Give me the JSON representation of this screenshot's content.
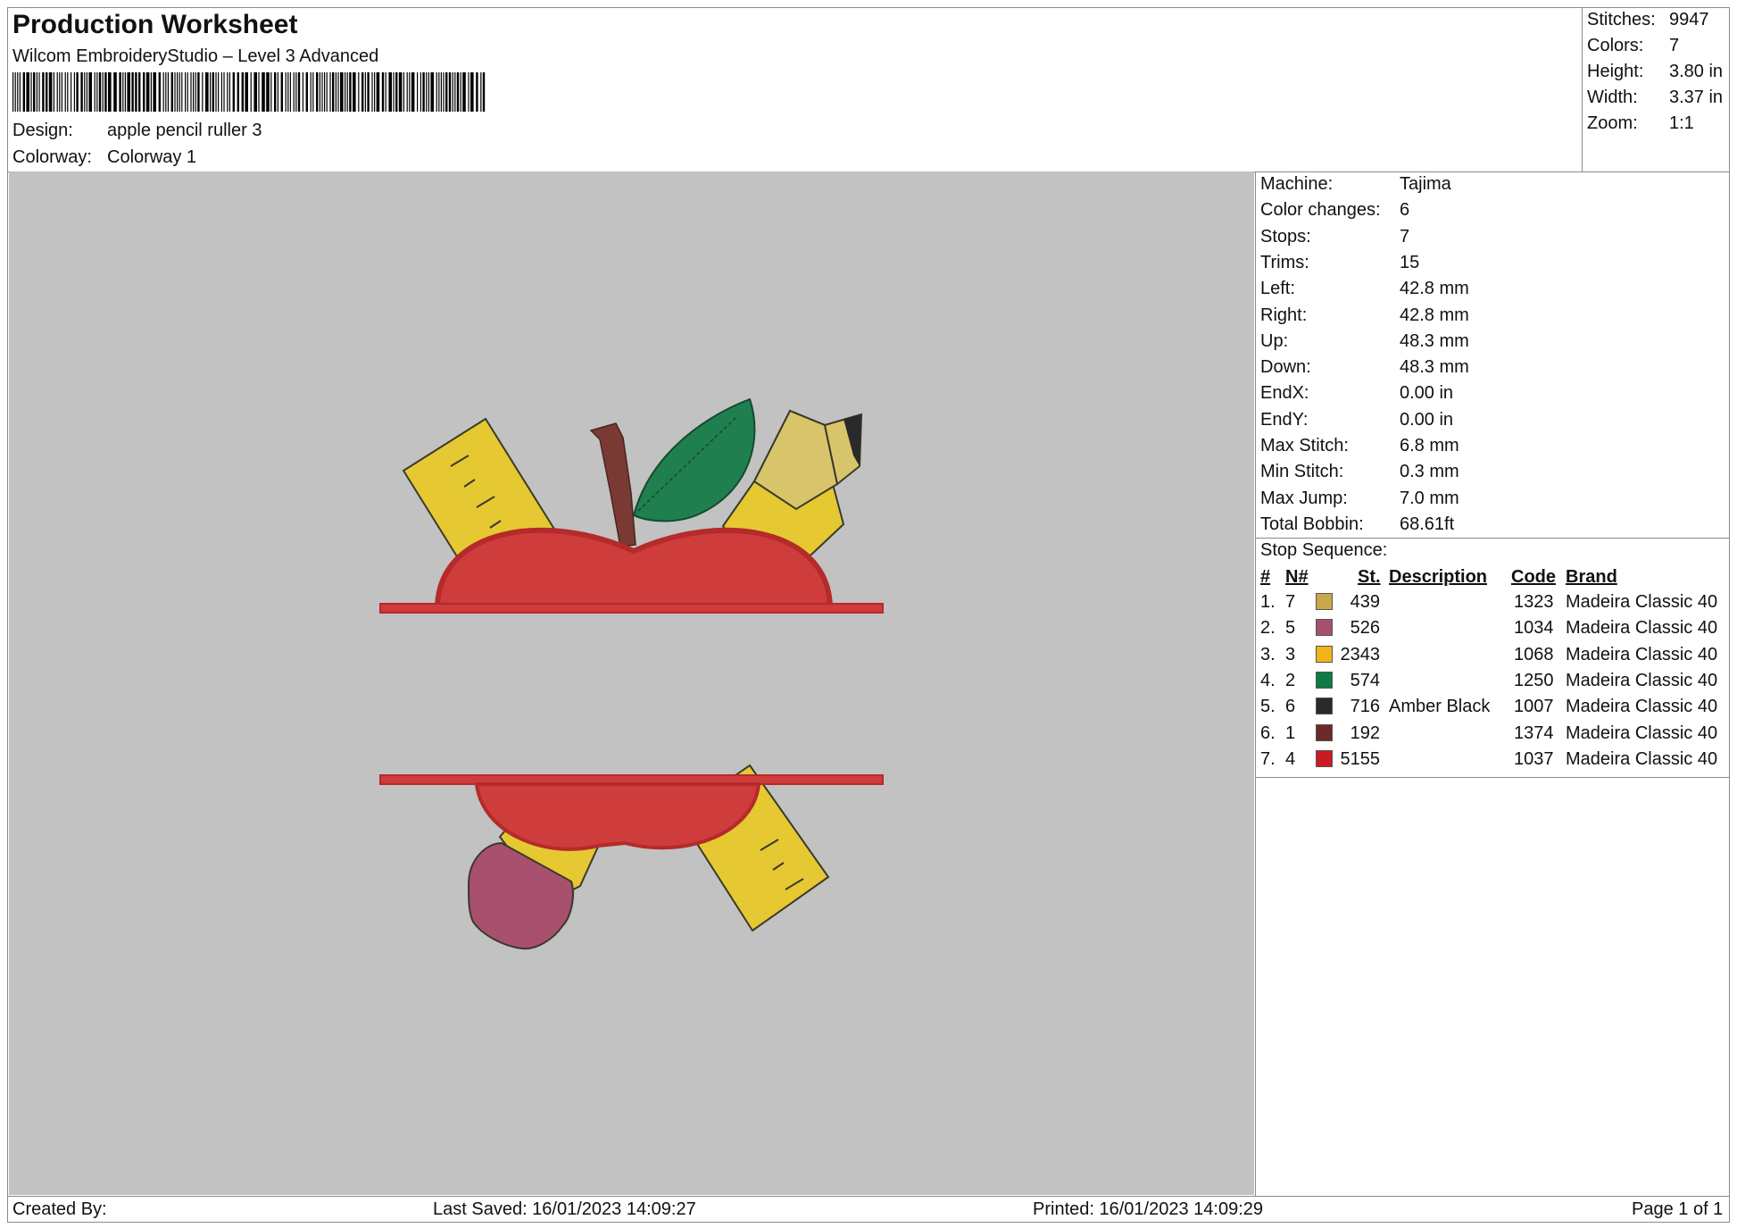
{
  "header": {
    "title": "Production Worksheet",
    "software": "Wilcom EmbroideryStudio – Level 3 Advanced",
    "design_label": "Design:",
    "design_value": "apple pencil ruller 3",
    "colorway_label": "Colorway:",
    "colorway_value": "Colorway 1"
  },
  "summary": [
    {
      "label": "Stitches:",
      "value": "9947"
    },
    {
      "label": "Colors:",
      "value": "7"
    },
    {
      "label": "Height:",
      "value": "3.80 in"
    },
    {
      "label": "Width:",
      "value": "3.37 in"
    },
    {
      "label": "Zoom:",
      "value": "1:1"
    }
  ],
  "machine_info": [
    {
      "label": "Machine:",
      "value": "Tajima"
    },
    {
      "label": "Color changes:",
      "value": "6"
    },
    {
      "label": "Stops:",
      "value": "7"
    },
    {
      "label": "Trims:",
      "value": "15"
    },
    {
      "label": "Left:",
      "value": "42.8 mm"
    },
    {
      "label": "Right:",
      "value": "42.8 mm"
    },
    {
      "label": "Up:",
      "value": "48.3 mm"
    },
    {
      "label": "Down:",
      "value": "48.3 mm"
    },
    {
      "label": "EndX:",
      "value": "0.00 in"
    },
    {
      "label": "EndY:",
      "value": "0.00 in"
    },
    {
      "label": "Max Stitch:",
      "value": "6.8 mm"
    },
    {
      "label": "Min Stitch:",
      "value": "0.3 mm"
    },
    {
      "label": "Max Jump:",
      "value": "7.0 mm"
    },
    {
      "label": "Total Bobbin:",
      "value": "68.61ft"
    }
  ],
  "stop_sequence": {
    "title": "Stop Sequence:",
    "columns": {
      "num": "#",
      "n": "N#",
      "st": "St.",
      "description": "Description",
      "code": "Code",
      "brand": "Brand"
    },
    "rows": [
      {
        "num": "1.",
        "n": "7",
        "color": "#c9a84c",
        "st": "439",
        "description": "",
        "code": "1323",
        "brand": "Madeira Classic 40"
      },
      {
        "num": "2.",
        "n": "5",
        "color": "#a8506e",
        "st": "526",
        "description": "",
        "code": "1034",
        "brand": "Madeira Classic 40"
      },
      {
        "num": "3.",
        "n": "3",
        "color": "#f2b21a",
        "st": "2343",
        "description": "",
        "code": "1068",
        "brand": "Madeira Classic 40"
      },
      {
        "num": "4.",
        "n": "2",
        "color": "#0e7a45",
        "st": "574",
        "description": "",
        "code": "1250",
        "brand": "Madeira Classic 40"
      },
      {
        "num": "5.",
        "n": "6",
        "color": "#2a2a2a",
        "st": "716",
        "description": "Amber Black",
        "code": "1007",
        "brand": "Madeira Classic 40"
      },
      {
        "num": "6.",
        "n": "1",
        "color": "#6b2a2a",
        "st": "192",
        "description": "",
        "code": "1374",
        "brand": "Madeira Classic 40"
      },
      {
        "num": "7.",
        "n": "4",
        "color": "#cc1a22",
        "st": "5155",
        "description": "",
        "code": "1037",
        "brand": "Madeira Classic 40"
      }
    ]
  },
  "footer": {
    "created_by": "Created By:",
    "last_saved": "Last Saved: 16/01/2023 14:09:27",
    "printed": "Printed: 16/01/2023 14:09:29",
    "page": "Page 1 of 1"
  },
  "preview_colors": {
    "background": "#c2c2c2",
    "apple_red": "#cf3c3c",
    "apple_outline": "#b52a2a",
    "ruler_yellow": "#e6c832",
    "pencil_tan": "#d8c46a",
    "leaf_green": "#1f7f4f",
    "stem_brown": "#7a3a34",
    "eraser_pink": "#a8506e",
    "lead_black": "#2a2a2a"
  }
}
